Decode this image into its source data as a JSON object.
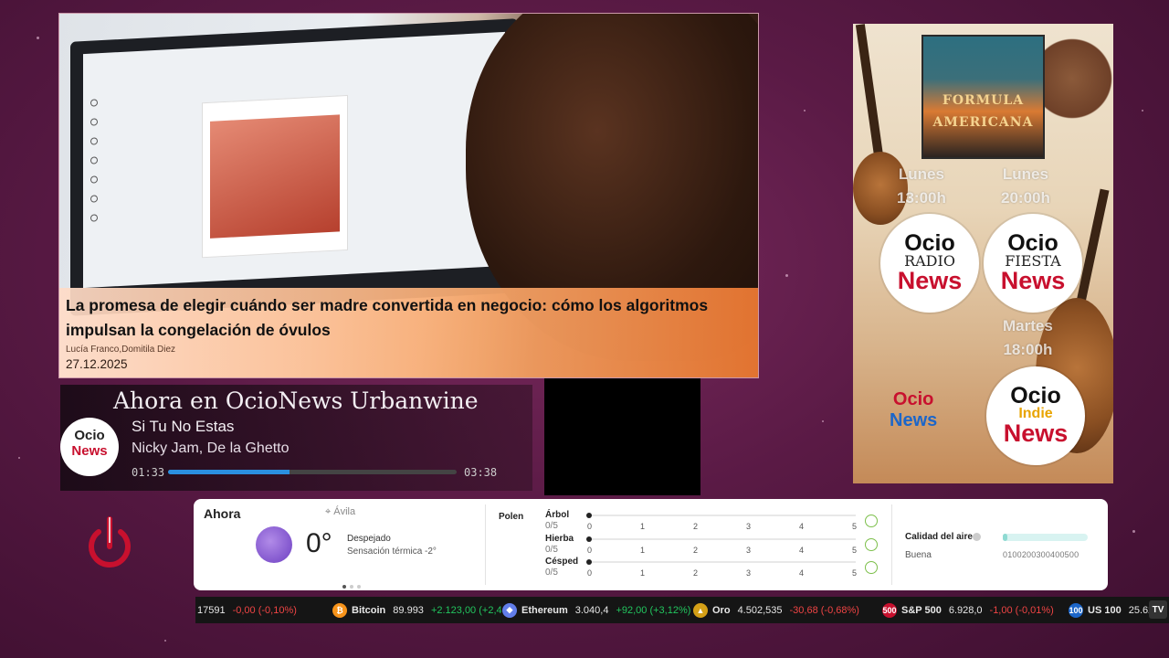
{
  "news": {
    "headline": "La promesa de elegir cuándo ser madre convertida en negocio: cómo los algoritmos impulsan la congelación de óvulos",
    "authors": "Lucía Franco,Domitila Diez",
    "date": "27.12.2025"
  },
  "player": {
    "title": "Ahora en OcioNews Urbanwine",
    "song": "Si Tu No Estas",
    "artist": "Nicky Jam, De la Ghetto",
    "elapsed": "01:33",
    "duration": "03:38",
    "progress": 0.42,
    "logo_top": "Ocio",
    "logo_bottom": "News"
  },
  "poster": {
    "album_title": "FORMULA AMERICANA",
    "slots": [
      {
        "day": "Lunes",
        "time": "13:00h"
      },
      {
        "day": "Lunes",
        "time": "20:00h"
      },
      {
        "day": "Martes",
        "time": "18:00h"
      }
    ],
    "badges": [
      {
        "top": "Ocio",
        "mid": "RADIO",
        "bottom": "News"
      },
      {
        "top": "Ocio",
        "mid": "FIESTA",
        "bottom": "News"
      },
      {
        "top": "Ocio",
        "mid": "Indie",
        "bottom": "News"
      }
    ],
    "small_logo": {
      "top": "Ocio",
      "bottom": "News"
    }
  },
  "weather": {
    "now_label": "Ahora",
    "location": "Ávila",
    "temperature": "0°",
    "condition": "Despejado",
    "feels_like": "Sensación térmica -2°",
    "icon": "moon-stars-icon",
    "pollen_title": "Polen",
    "pollen": [
      {
        "name": "Árbol",
        "score": "0/5",
        "value": 0
      },
      {
        "name": "Hierba",
        "score": "0/5",
        "value": 0
      },
      {
        "name": "Césped",
        "score": "0/5",
        "value": 0
      }
    ],
    "pollen_scale": [
      "0",
      "1",
      "2",
      "3",
      "4",
      "5"
    ],
    "air_quality_title": "Calidad del aire",
    "air_quality_label": "Buena",
    "air_quality_scale": "0100200300400500",
    "air_quality_fill": 0.05
  },
  "ticker": [
    {
      "name": "",
      "price": "17591",
      "change": "-0,00 (-0,10%)",
      "dir": "dn",
      "icon": "",
      "color": "#151515"
    },
    {
      "name": "Bitcoin",
      "price": "89.993",
      "change": "+2.123,00 (+2,4",
      "dir": "up",
      "icon": "₿",
      "color": "#f7931a"
    },
    {
      "name": "Ethereum",
      "price": "3.040,4",
      "change": "+92,00 (+3,12%)",
      "dir": "up",
      "icon": "◆",
      "color": "#627eea"
    },
    {
      "name": "Oro",
      "price": "4.502,535",
      "change": "-30,68 (-0,68%)",
      "dir": "dn",
      "icon": "▲",
      "color": "#d4a017"
    },
    {
      "name": "S&P 500",
      "price": "6.928,0",
      "change": "-1,00 (-0,01%)",
      "dir": "dn",
      "icon": "500",
      "color": "#c8102e"
    },
    {
      "name": "US 100",
      "price": "25.62",
      "change": "",
      "dir": "up",
      "icon": "100",
      "color": "#1c66c9"
    }
  ],
  "colors": {
    "accent_red": "#c8102e",
    "progress_blue": "#2b8fe0",
    "up": "#22c55e",
    "down": "#ef4444"
  }
}
